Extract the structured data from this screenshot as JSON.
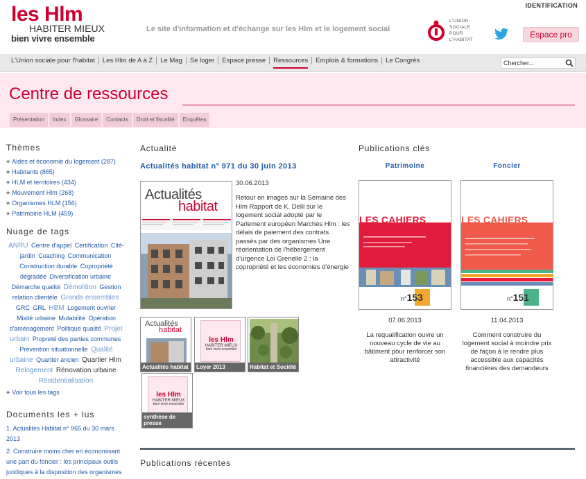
{
  "header": {
    "logo_main": "les Hlm",
    "logo_sub": "HABITER MIEUX",
    "logo_sub2": "bien vivre ensemble",
    "tagline": "Le site d'information et d'échange sur les Hlm et le logement social",
    "union_text": [
      "L'UNION",
      "SOCIALE",
      "POUR",
      "L'HABITAT"
    ],
    "identification": "IDENTIFICATION",
    "espace_pro": "Espace pro",
    "brand_color": "#cc0033",
    "twitter_color": "#2aa7e0"
  },
  "nav": {
    "items": [
      {
        "label": "L'Union sociale pour l'habitat",
        "active": false
      },
      {
        "label": "Les Hlm de A à Z",
        "active": false
      },
      {
        "label": "Le Mag",
        "active": false
      },
      {
        "label": "Se loger",
        "active": false
      },
      {
        "label": "Espace presse",
        "active": false
      },
      {
        "label": "Ressources",
        "active": true
      },
      {
        "label": "Emplois & formations",
        "active": false
      },
      {
        "label": "Le Congrès",
        "active": false
      }
    ],
    "search_placeholder": "Chercher..."
  },
  "page": {
    "title": "Centre de ressources",
    "tabs": [
      "Présentation",
      "Index",
      "Glossaire",
      "Contacts",
      "Droit et fiscalité",
      "Enquêtes"
    ]
  },
  "sidebar": {
    "themes_heading": "Thèmes",
    "themes": [
      "Aides et économie du logement (287)",
      "Habitants (865)",
      "HLM et territoires (434)",
      "Mouvement Hlm (268)",
      "Organismes HLM (156)",
      "Patrimoine HLM (459)"
    ],
    "tags_heading": "Nuage de tags",
    "tags": [
      {
        "text": "ANRU",
        "style": "l"
      },
      {
        "text": "Centre d'appel",
        "style": "d"
      },
      {
        "text": "Certification",
        "style": "d"
      },
      {
        "text": "Cité-jardin",
        "style": "d"
      },
      {
        "text": "Coaching",
        "style": "d"
      },
      {
        "text": "Communication",
        "style": "d"
      },
      {
        "text": "Construction durable",
        "style": "d"
      },
      {
        "text": "Copropriété dégradée",
        "style": "d"
      },
      {
        "text": "Diversification urbaine",
        "style": "d"
      },
      {
        "text": "Démarche qualité",
        "style": "d"
      },
      {
        "text": "Démolition",
        "style": "l"
      },
      {
        "text": "Gestion relation clientèle",
        "style": "d"
      },
      {
        "text": "Grands ensembles",
        "style": "l"
      },
      {
        "text": "GRC",
        "style": "d"
      },
      {
        "text": "GRL",
        "style": "d"
      },
      {
        "text": "HBM",
        "style": "l"
      },
      {
        "text": "Logement ouvrier",
        "style": "d"
      },
      {
        "text": "Mixité urbaine",
        "style": "d"
      },
      {
        "text": "Mutabilité",
        "style": "d"
      },
      {
        "text": "Opération d'aménagement",
        "style": "d"
      },
      {
        "text": "Politique qualité",
        "style": "d"
      },
      {
        "text": "Projet urbain",
        "style": "l"
      },
      {
        "text": "Propreté des parties communes",
        "style": "d"
      },
      {
        "text": "Prévention situationnelle",
        "style": "d"
      },
      {
        "text": "Qualité urbaine",
        "style": "l"
      },
      {
        "text": "Quartier ancien",
        "style": "d"
      },
      {
        "text": "Quartier Hlm",
        "style": "b"
      },
      {
        "text": "Relogement",
        "style": "l"
      },
      {
        "text": "Rénovation urbaine",
        "style": "b"
      },
      {
        "text": "Résidentialisation",
        "style": "l"
      }
    ],
    "all_tags": "Voir tous les tags",
    "docs_heading": "Documents les + lus",
    "docs": [
      "1. Actualités Habitat n° 965 du 30 mars 2013",
      "2. Construire moins cher en économisant une part du foncier : les principaux outils juridiques à la disposition des organismes Hlm"
    ]
  },
  "actualite": {
    "heading": "Actualité",
    "issue_title": "Actualités habitat n° 971 du 30 juin 2013",
    "cover_line1": "Actualités",
    "cover_line2": "habitat",
    "date": "30.06.2013",
    "summary": "Retour en images sur la Semaine des Hlm Rapport de K. Delli sur le logement social adopté par le Parlement européen Marchés Hlm : les délais de paiement des contrats passés par des organismes Une réorientation de l'hébergement d'urgence Loi Grenelle 2 : la copropriété et les économies d'énergie",
    "thumbs": [
      {
        "caption": "Actualités habitat"
      },
      {
        "caption": "Loyer 2013"
      },
      {
        "caption": "Habitat et Société"
      },
      {
        "caption": "synthèse de presse"
      }
    ],
    "recent_heading": "Publications récentes"
  },
  "publications": {
    "heading": "Publications clés",
    "items": [
      {
        "name": "Patrimoine",
        "cover_title": "LES CAHIERS",
        "cover_num": "153",
        "date": "07.06.2013",
        "desc": "La requalification ouvre un nouveau cycle de vie au bâtiment pour renforcer son attractivité"
      },
      {
        "name": "Foncier",
        "cover_title": "LES CAHIERS",
        "cover_num": "151",
        "date": "11.04.2013",
        "desc": "Comment construire du logement social à moindre prix de façon à le rendre plus accessible aux capacités financières des demandeurs"
      }
    ]
  }
}
